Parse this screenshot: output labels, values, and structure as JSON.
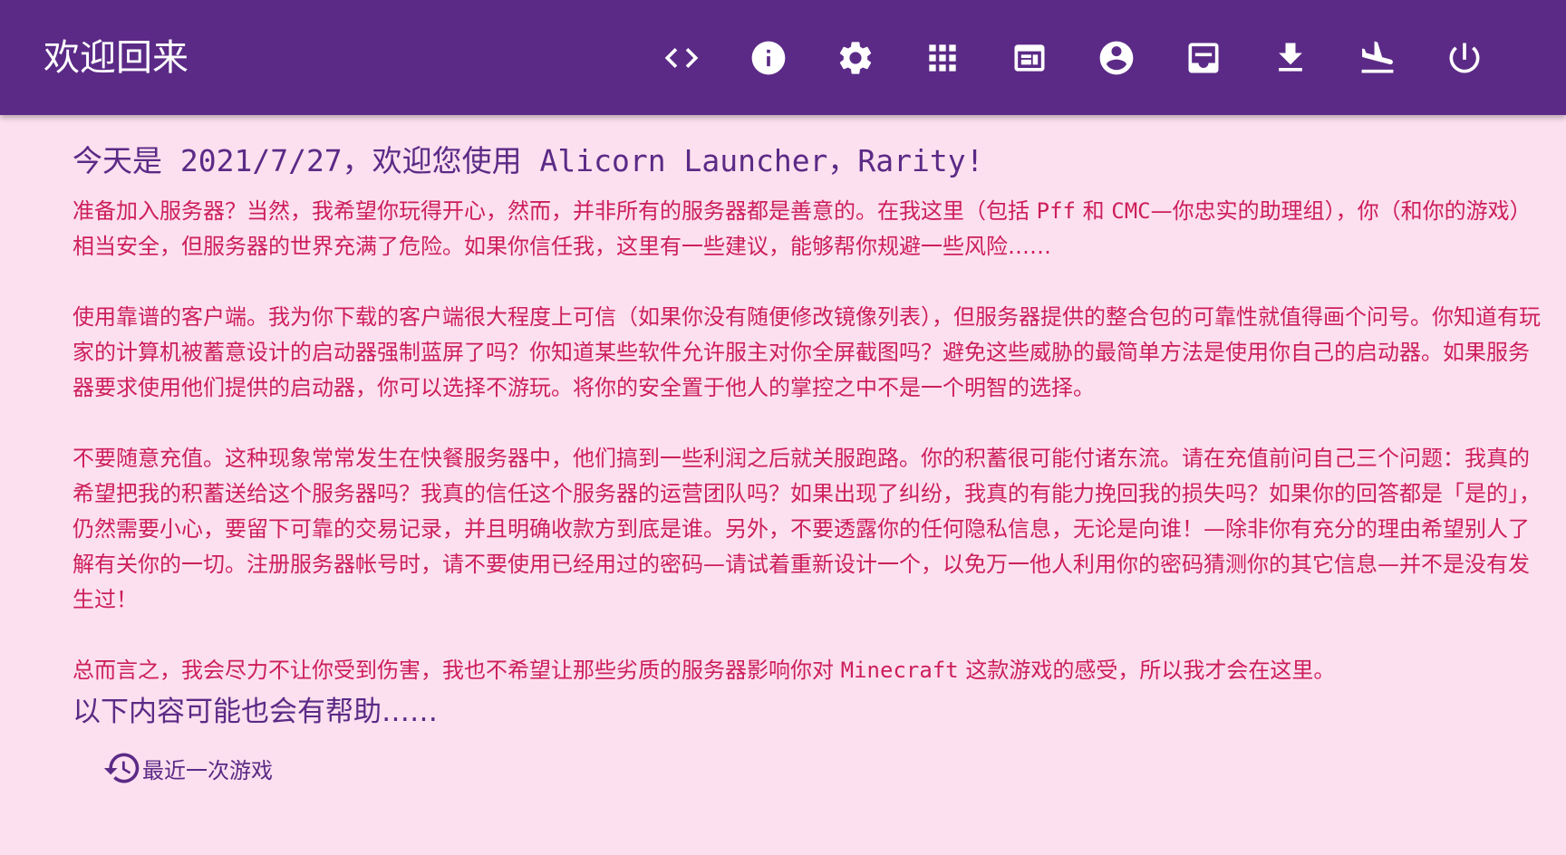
{
  "header": {
    "title": "欢迎回来",
    "toolbar": [
      {
        "name": "code-icon"
      },
      {
        "name": "info-icon"
      },
      {
        "name": "settings-icon"
      },
      {
        "name": "apps-grid-icon"
      },
      {
        "name": "web-asset-icon"
      },
      {
        "name": "account-circle-icon"
      },
      {
        "name": "inbox-icon"
      },
      {
        "name": "download-icon"
      },
      {
        "name": "flight-land-icon"
      },
      {
        "name": "power-icon"
      }
    ],
    "bar_color": "#5b2a86"
  },
  "main": {
    "greeting": "今天是 2021/7/27，欢迎您使用 Alicorn Launcher，Rarity!",
    "paragraphs": {
      "p1_a": "准备加入服务器？当然，我希望你玩得开心，然而，并非所有的服务器都是善意的。在我这里（包括 ",
      "p1_pff": "Pff",
      "p1_b": " 和 ",
      "p1_cmc": "CMC",
      "p1_c": "—你忠实的助理组），你（和你的游戏）相当安全，但服务器的世界充满了危险。如果你信任我，这里有一些建议，能够帮你规避一些风险……",
      "p2": "使用靠谱的客户端。我为你下载的客户端很大程度上可信（如果你没有随便修改镜像列表），但服务器提供的整合包的可靠性就值得画个问号。你知道有玩家的计算机被蓄意设计的启动器强制蓝屏了吗？你知道某些软件允许服主对你全屏截图吗？避免这些威胁的最简单方法是使用你自己的启动器。如果服务器要求使用他们提供的启动器，你可以选择不游玩。将你的安全置于他人的掌控之中不是一个明智的选择。",
      "p3": "不要随意充值。这种现象常常发生在快餐服务器中，他们搞到一些利润之后就关服跑路。你的积蓄很可能付诸东流。请在充值前问自己三个问题：我真的希望把我的积蓄送给这个服务器吗？我真的信任这个服务器的运营团队吗？如果出现了纠纷，我真的有能力挽回我的损失吗？如果你的回答都是「是的」，仍然需要小心，要留下可靠的交易记录，并且明确收款方到底是谁。另外，不要透露你的任何隐私信息，无论是向谁！—除非你有充分的理由希望别人了解有关你的一切。注册服务器帐号时，请不要使用已经用过的密码—请试着重新设计一个，以免万一他人利用你的密码猜测你的其它信息—并不是没有发生过！",
      "p4_a": "总而言之，我会尽力不让你受到伤害，我也不希望让那些劣质的服务器影响你对 ",
      "p4_mc": "Minecraft",
      "p4_b": " 这款游戏的感受，所以我才会在这里。"
    },
    "subheading": "以下内容可能也会有帮助……",
    "recent_game_link": {
      "icon": "history-icon",
      "label": "最近一次游戏"
    }
  },
  "colors": {
    "background": "#fde0ef",
    "accent": "#5b2a86",
    "warning_text": "#cc1f5a",
    "on_accent": "#ffffff"
  }
}
